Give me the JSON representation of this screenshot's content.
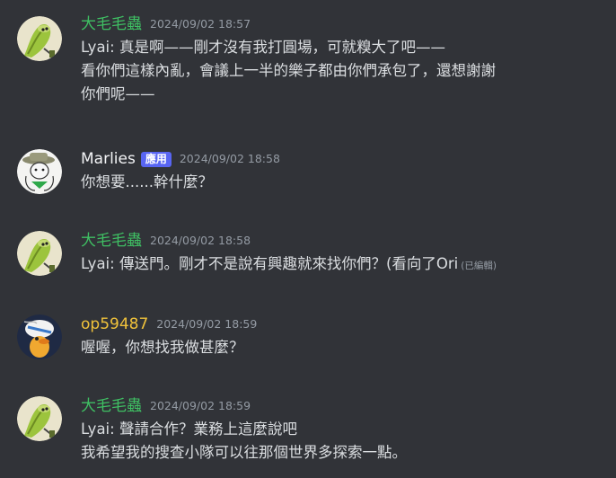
{
  "messages": [
    {
      "author": "大毛毛蟲",
      "timestamp": "2024/09/02 18:57",
      "lines": [
        "Lyai: 真是啊——剛才沒有我打圓場，可就糗大了吧——",
        "看你們這樣內亂，會議上一半的樂子都由你們承包了，還想謝謝",
        "你們呢——"
      ]
    },
    {
      "author": "Marlies",
      "badge": "應用",
      "timestamp": "2024/09/02 18:58",
      "lines": [
        "你想要......幹什麼？"
      ]
    },
    {
      "author": "大毛毛蟲",
      "timestamp": "2024/09/02 18:58",
      "lines": [
        "Lyai: 傳送門。剛才不是說有興趣就來找你們？(看向了Ori"
      ],
      "edited": "(已編輯)"
    },
    {
      "author": "op59487",
      "timestamp": "2024/09/02 18:59",
      "lines": [
        "喔喔，你想找我做甚麼？"
      ]
    },
    {
      "author": "大毛毛蟲",
      "timestamp": "2024/09/02 18:59",
      "lines": [
        "Lyai: 聲請合作？業務上這麼說吧",
        "我希望我的搜查小隊可以往那個世界多探索一點。"
      ]
    }
  ],
  "colors": {
    "background": "#313338",
    "author_green": "#3fbf63",
    "author_yellow": "#f0c23b",
    "badge_blurple": "#5865f2",
    "timestamp_gray": "#949ba4",
    "text": "#dbdee1"
  },
  "avatar_icons": [
    "green-slug-avatar-icon",
    "cowboy-character-avatar-icon",
    "green-slug-avatar-icon",
    "duck-character-avatar-icon",
    "green-slug-avatar-icon"
  ]
}
